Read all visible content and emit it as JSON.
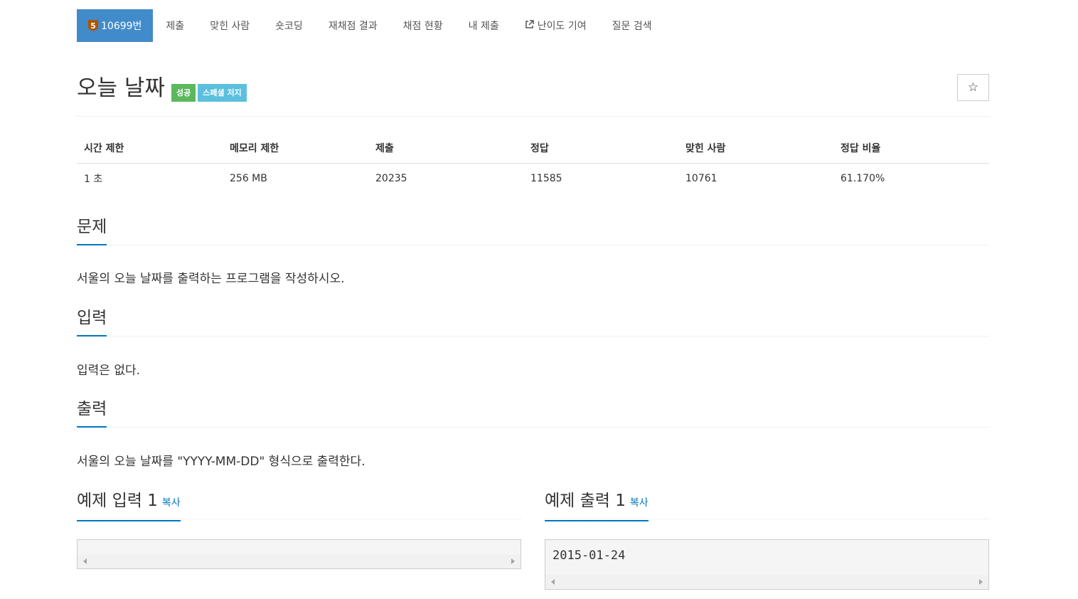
{
  "nav": {
    "problem_tier": "5",
    "problem_number": "10699번",
    "items": [
      "제출",
      "맞힌 사람",
      "숏코딩",
      "재채점 결과",
      "채점 현황",
      "내 제출",
      "난이도 기여",
      "질문 검색"
    ]
  },
  "title": {
    "text": "오늘 날짜",
    "label_success": "성공",
    "label_info": "스페셜 저지",
    "star": "☆"
  },
  "info": {
    "headers": [
      "시간 제한",
      "메모리 제한",
      "제출",
      "정답",
      "맞힌 사람",
      "정답 비율"
    ],
    "values": [
      "1 초",
      "256 MB",
      "20235",
      "11585",
      "10761",
      "61.170%"
    ]
  },
  "sections": {
    "problem": {
      "title": "문제",
      "body": "서울의 오늘 날짜를 출력하는 프로그램을 작성하시오."
    },
    "input": {
      "title": "입력",
      "body": "입력은 없다."
    },
    "output": {
      "title": "출력",
      "body": "서울의 오늘 날짜를 \"YYYY-MM-DD\" 형식으로 출력한다."
    }
  },
  "samples": {
    "input_title": "예제 입력 1",
    "output_title": "예제 출력 1",
    "copy_label": "복사",
    "input_value": "",
    "output_value": "2015-01-24"
  },
  "colors": {
    "primary": "#428bca",
    "success": "#5cb85c",
    "info": "#5bc0de",
    "link": "#0076c0",
    "tier_bronze": "#ad5600"
  }
}
